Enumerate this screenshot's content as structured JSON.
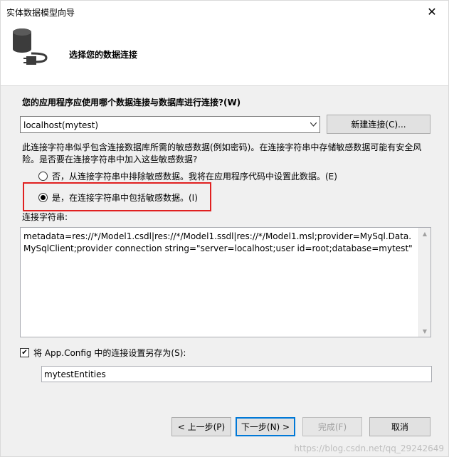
{
  "window": {
    "title": "实体数据模型向导",
    "close_glyph": "✕"
  },
  "header": {
    "heading": "选择您的数据连接"
  },
  "question": "您的应用程序应使用哪个数据连接与数据库进行连接?(W)",
  "connection_combo": {
    "value": "localhost(mytest)"
  },
  "new_connection_button": "新建连接(C)...",
  "warning_text": "此连接字符串似乎包含连接数据库所需的敏感数据(例如密码)。在连接字符串中存储敏感数据可能有安全风险。是否要在连接字符串中加入这些敏感数据?",
  "radio_exclude": {
    "label": "否，从连接字符串中排除敏感数据。我将在应用程序代码中设置此数据。(E)",
    "checked": false
  },
  "radio_include": {
    "label": "是，在连接字符串中包括敏感数据。(I)",
    "checked": true
  },
  "connection_string_label": "连接字符串:",
  "connection_string": "metadata=res://*/Model1.csdl|res://*/Model1.ssdl|res://*/Model1.msl;provider=MySql.Data.MySqlClient;provider connection string=\"server=localhost;user id=root;database=mytest\"",
  "save_config": {
    "label": "将 App.Config 中的连接设置另存为(S):",
    "checked": true,
    "value": "mytestEntities"
  },
  "buttons": {
    "back": "< 上一步(P)",
    "next": "下一步(N) >",
    "finish": "完成(F)",
    "cancel": "取消"
  },
  "watermark": "https://blog.csdn.net/qq_29242649",
  "colors": {
    "highlight_border": "#e02020",
    "accent": "#0078d7"
  },
  "icons": {
    "database": "database-plug-icon",
    "dropdown": "chevron-down-icon",
    "close": "close-icon"
  }
}
